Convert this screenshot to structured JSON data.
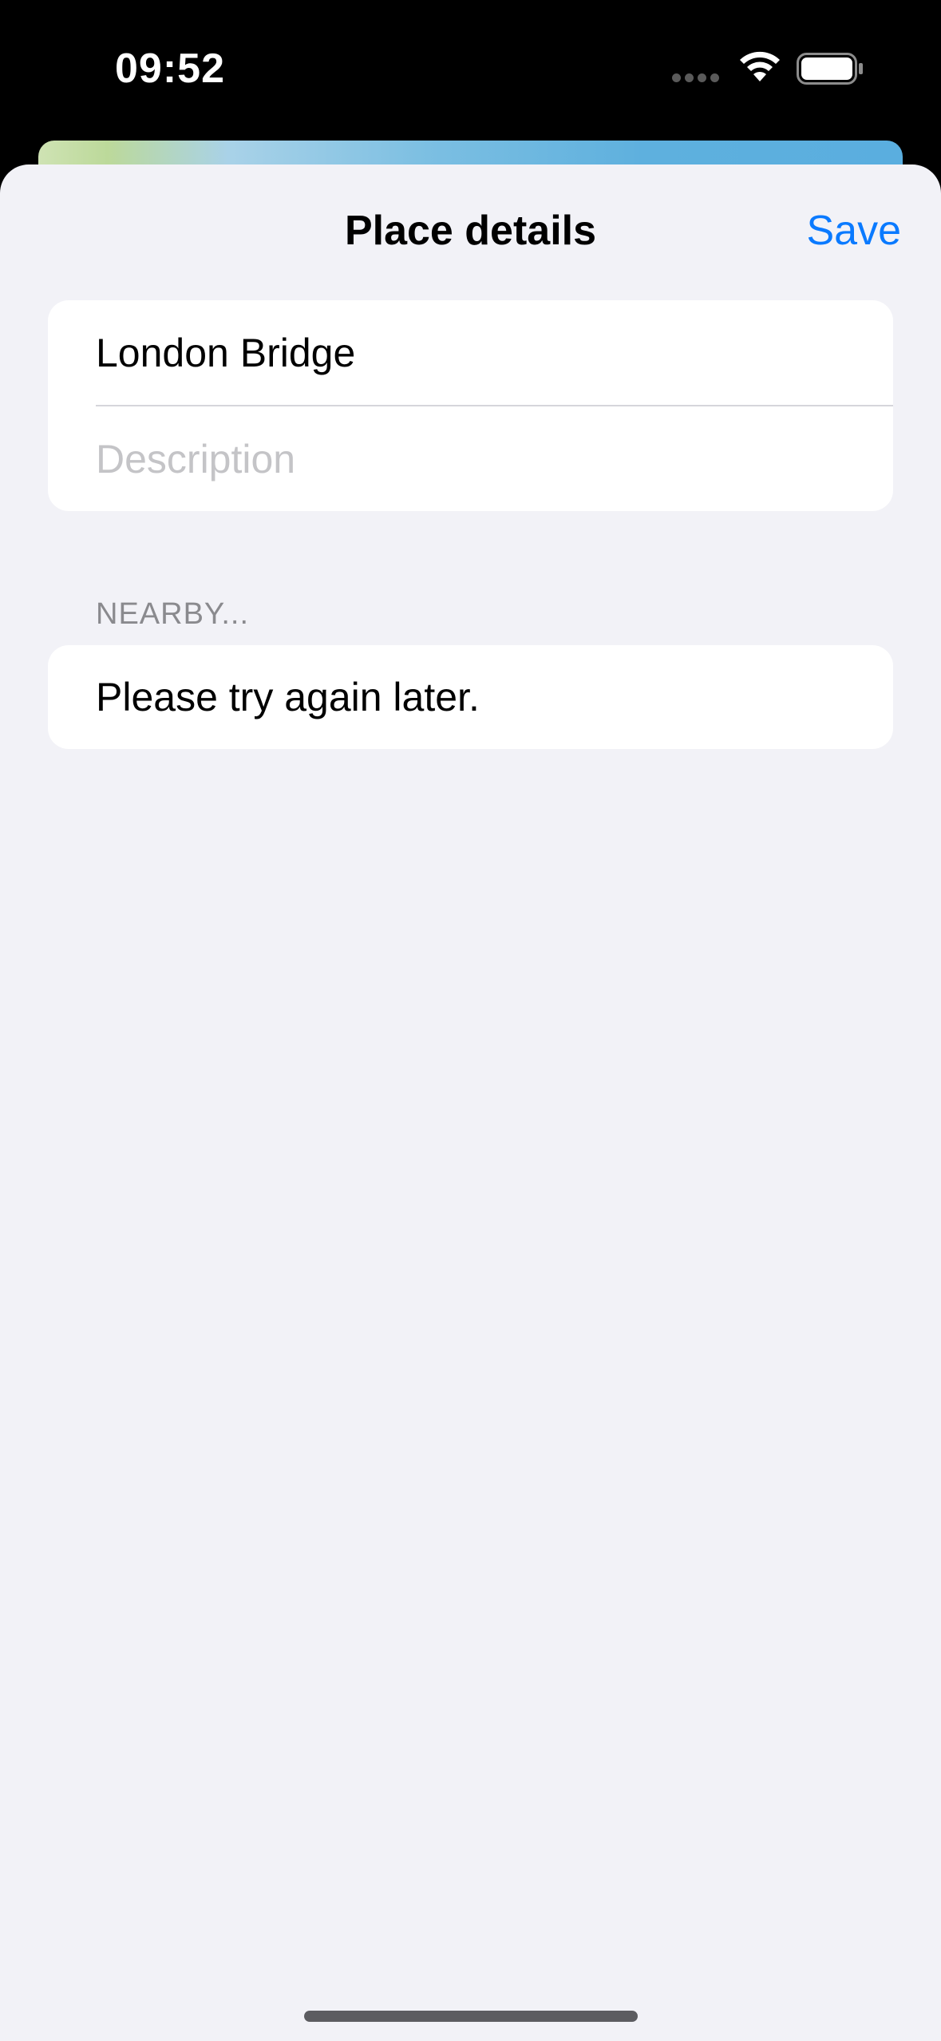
{
  "status_bar": {
    "time": "09:52",
    "icons": [
      "cellular-signal-icon",
      "wifi-icon",
      "battery-icon"
    ]
  },
  "sheet": {
    "title": "Place details",
    "save_label": "Save"
  },
  "form": {
    "name_value": "London Bridge",
    "description_placeholder": "Description",
    "description_value": ""
  },
  "nearby": {
    "header": "NEARBY...",
    "message": "Please try again later."
  },
  "colors": {
    "accent": "#0a7aff",
    "background": "#f2f2f7",
    "card": "#ffffff",
    "secondary_text": "#8a8a8e"
  }
}
